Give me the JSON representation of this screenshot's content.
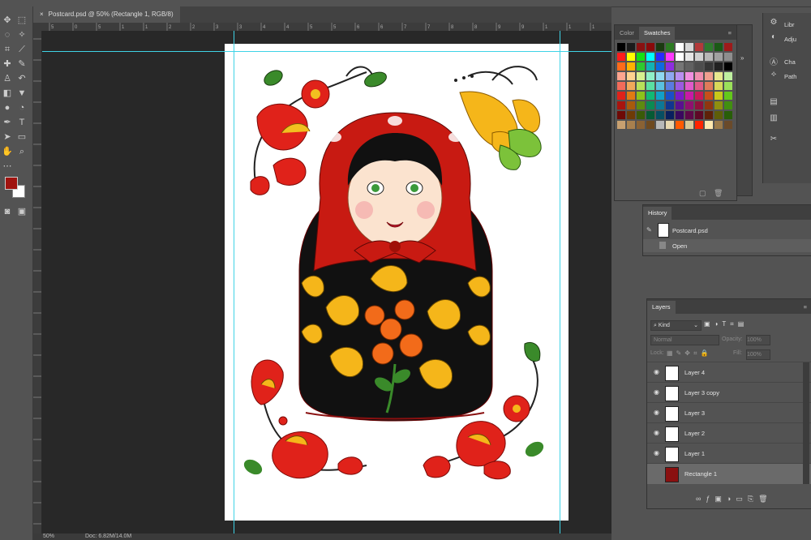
{
  "document": {
    "tab_title": "Postcard.psd @ 50% (Rectangle 1, RGB/8)",
    "close_glyph": "×"
  },
  "status": {
    "zoom": "50%",
    "doc_size": "Doc: 6.82M/14.0M"
  },
  "rulers": {
    "top": [
      "5",
      "0",
      "5",
      "1",
      "1",
      "2",
      "2",
      "3",
      "3",
      "4",
      "4",
      "5",
      "5",
      "6",
      "6",
      "7",
      "7",
      "8",
      "8",
      "9",
      "9",
      "1",
      "1",
      "1"
    ]
  },
  "swatches_panel": {
    "tabs": [
      "Color",
      "Swatches"
    ],
    "active_tab": "Swatches",
    "colors": [
      [
        "#000000",
        "#1b1b1b",
        "#8a1111",
        "#8a0a0a",
        "#1b3a10",
        "#2c7b22",
        "#ffffff",
        "#d7d7d7",
        "#b43a3a",
        "#2f7b2e",
        "#1a5a16",
        "#9e1a1a"
      ],
      [
        "#ff1c1c",
        "#ffff00",
        "#14e014",
        "#00ffff",
        "#2a2aff",
        "#ff38ff",
        "#ffffff",
        "#e6e6e6",
        "#d0d0d0",
        "#b7b7b7",
        "#a1a1a1",
        "#8e8e8e"
      ],
      [
        "#ff6b1a",
        "#ffb300",
        "#2ec92e",
        "#12b3b3",
        "#0f6ae0",
        "#8e2ee0",
        "#767676",
        "#616161",
        "#4d4d4d",
        "#363636",
        "#212121",
        "#000000"
      ],
      [
        "#ffa58f",
        "#ffd28f",
        "#d6f08f",
        "#8ff0c8",
        "#8fd8f0",
        "#8fa8f0",
        "#b98ff0",
        "#f08fe0",
        "#f08fb0",
        "#f09f8f",
        "#e8e88f",
        "#bff0a0"
      ],
      [
        "#f26b5a",
        "#f2a85a",
        "#b8e05a",
        "#5ae0a2",
        "#5ac1e0",
        "#5a7be0",
        "#9c5ae0",
        "#e05ac9",
        "#e05a88",
        "#e07b5a",
        "#d9d95a",
        "#9be05a"
      ],
      [
        "#e0221a",
        "#e07b12",
        "#8cc21a",
        "#12b874",
        "#12a0c8",
        "#1a4fc8",
        "#7b1ac8",
        "#c81aa5",
        "#c81a5a",
        "#c84f1a",
        "#c8c81a",
        "#63c81a"
      ],
      [
        "#a8140e",
        "#a85a0c",
        "#5e8a10",
        "#0c8a52",
        "#0c7896",
        "#10358f",
        "#5a108f",
        "#8f106f",
        "#8f103d",
        "#8f360f",
        "#8f8f10",
        "#418f10"
      ],
      [
        "#6e0a06",
        "#6e3a06",
        "#3a5a08",
        "#065a34",
        "#064e62",
        "#081f5e",
        "#3a085e",
        "#5e0848",
        "#5e0826",
        "#5e2108",
        "#5e5e08",
        "#285e08"
      ],
      [
        "#c8a070",
        "#a8804e",
        "#8a6234",
        "#6e4a20",
        "#b8b8b8",
        "#e8d8b0",
        "#ff5a00",
        "#d8c898",
        "#ff2400",
        "#ffe8b0",
        "#9a7a4a",
        "#6a4a2a"
      ]
    ]
  },
  "history_panel": {
    "title": "History",
    "snapshot_label": "Postcard.psd",
    "items": [
      "Open"
    ]
  },
  "layers_panel": {
    "title": "Layers",
    "kind_label": "Kind",
    "blend_mode": "Normal",
    "opacity_label": "Opacity:",
    "opacity_value": "100%",
    "lock_label": "Lock:",
    "fill_label": "Fill:",
    "fill_value": "100%",
    "layers": [
      {
        "name": "Layer 4",
        "visible": true,
        "selected": false
      },
      {
        "name": "Layer 3 copy",
        "visible": true,
        "selected": false
      },
      {
        "name": "Layer 3",
        "visible": true,
        "selected": false
      },
      {
        "name": "Layer 2",
        "visible": true,
        "selected": false
      },
      {
        "name": "Layer 1",
        "visible": true,
        "selected": false
      },
      {
        "name": "Rectangle 1",
        "visible": false,
        "selected": true
      }
    ],
    "footer_icons": [
      "link-icon",
      "fx-icon",
      "mask-icon",
      "adjustment-icon",
      "group-icon",
      "new-layer-icon",
      "trash-icon"
    ]
  },
  "right_dock": {
    "items": [
      "Libr",
      "Adju",
      "Cha",
      "Path"
    ]
  },
  "colors": {
    "foreground": "#a0130f",
    "background": "#ffffff",
    "guide": "#3fd3e6"
  }
}
